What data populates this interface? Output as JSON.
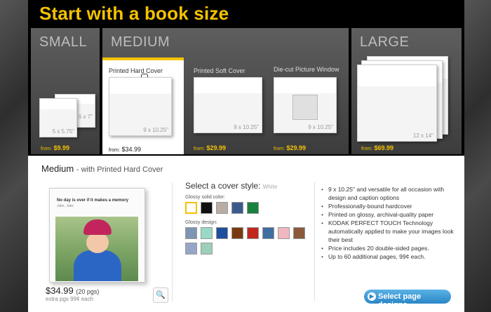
{
  "header": {
    "title": "Start with a book size"
  },
  "sizes": {
    "small": {
      "title": "SMALL",
      "books": [
        {
          "dims": "5 x 5.75\""
        },
        {
          "dims": "6 x 7\""
        }
      ],
      "price_from": "from:",
      "price": "$9.99"
    },
    "medium": {
      "title": "MEDIUM",
      "options": [
        {
          "title": "Printed Hard Cover",
          "dims": "9 x 10.25\"",
          "price_from": "from:",
          "price": "$34.99",
          "selected": true
        },
        {
          "title": "Printed Soft Cover",
          "dims": "9 x 10.25\"",
          "price_from": "from:",
          "price": "$29.99",
          "selected": false
        },
        {
          "title": "Die-cut Picture Window",
          "dims": "9 x 10.25\"",
          "price_from": "from:",
          "price": "$29.99",
          "selected": false
        }
      ]
    },
    "large": {
      "title": "LARGE",
      "dims_primary": "12 x 14\"",
      "price_from": "from:",
      "price": "$69.99"
    }
  },
  "detail": {
    "title": "Medium",
    "subtitle": "- with Printed Hard Cover",
    "preview": {
      "caption": "No day is over if it makes a memory",
      "subcaption": "Jake, Jake"
    },
    "price": "$34.99",
    "pages": "(20 pgs)",
    "extra": "extra pgs 99¢ each",
    "zoom_icon": "magnifier-icon"
  },
  "cover_style": {
    "heading": "Select a cover style:",
    "selected_name": "White",
    "solid_label": "Glossy solid color:",
    "solid_colors": [
      "#ffffff",
      "#111111",
      "#b8aea6",
      "#3b5a8c",
      "#1a8040"
    ],
    "design_label": "Glossy design:",
    "design_colors": [
      "#7c95b2",
      "#9ad8c8",
      "#1c4f9e",
      "#7a3a10",
      "#c0281c",
      "#3f6ea0",
      "#f0b7c1",
      "#8a5a3a",
      "#95a6c8",
      "#9cd0b8"
    ]
  },
  "features": [
    "9 x 10.25\" and versatile for all occasion with design and caption options",
    "Professionally-bound hardcover",
    "Printed on glossy, archival-quality paper",
    "KODAK PERFECT TOUCH Technology automatically applied to make your images look their best",
    "Price includes 20 double-sided pages.",
    "Up to 60 additional pages, 99¢ each."
  ],
  "cta": {
    "label": "Select page designs",
    "icon": "arrow-right-icon"
  },
  "colors": {
    "accent": "#f4c200",
    "cta": "#2a86c6"
  }
}
